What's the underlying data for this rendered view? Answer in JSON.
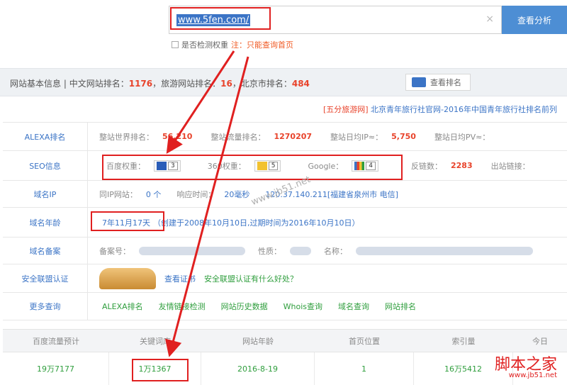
{
  "search": {
    "value": "www.5fen.com/",
    "clear": "×",
    "button": "查看分析"
  },
  "options": {
    "checkbox_label": "是否检测权重",
    "note": "注：只能查询首页"
  },
  "info": {
    "title": "网站基本信息",
    "cn_rank_label": "中文网站排名：",
    "cn_rank": "1176",
    "type_rank_label": "，旅游网站排名：",
    "type_rank": "16",
    "city_rank_label": "，北京市排名：",
    "city_rank": "484",
    "rank_button": "查看排名"
  },
  "news": {
    "tag": "[五分旅游网]",
    "text": "北京青年旅行社官网-2016年中国青年旅行社排名前列"
  },
  "rows": {
    "alexa": {
      "label": "ALEXA排名",
      "world_label": "整站世界排名：",
      "world": "56,210",
      "traffic_label": "整站流量排名：",
      "traffic": "1270207",
      "ip_label": "整站日均IP≈：",
      "ip": "5,750",
      "pv_label": "整站日均PV≈："
    },
    "seo": {
      "label": "SEO信息",
      "baidu_label": "百度权重：",
      "baidu": "3",
      "so360_label": "360权重：",
      "so360": "5",
      "google_label": "Google：",
      "google": "4",
      "backlinks_label": "反链数：",
      "backlinks": "2283",
      "outlinks_label": "出站链接："
    },
    "domain": {
      "label": "域名IP",
      "same_ip_label": "同IP网站：",
      "same_ip": "0 个",
      "response_label": "响应时间：",
      "response": "20毫秒",
      "ip": "120.37.140.211[福建省泉州市 电信]"
    },
    "age": {
      "label": "域名年龄",
      "age": "7年11月17天",
      "detail": "（创建于2008年10月10日,过期时间为2016年10月10日）"
    },
    "icp": {
      "label": "域名备案",
      "icp_label": "备案号：",
      "nature_label": "性质：",
      "name_label": "名称："
    },
    "safety": {
      "label": "安全联盟认证",
      "link": "查看证书",
      "question": "安全联盟认证有什么好处？"
    },
    "more": {
      "label": "更多查询",
      "links": [
        "ALEXA排名",
        "友情链接检测",
        "网站历史数据",
        "Whois查询",
        "域名查询",
        "网站排名"
      ]
    }
  },
  "bottom": {
    "headers": [
      "百度流量预计",
      "关键词库",
      "网站年龄",
      "首页位置",
      "索引量",
      "今日"
    ],
    "values": [
      "19万7177",
      "1万1367",
      "2016-8-19",
      "1",
      "16万5412"
    ]
  },
  "watermark": "www.jb51.net",
  "site_logo": "脚本之家",
  "site_url": "www.jb51.net"
}
